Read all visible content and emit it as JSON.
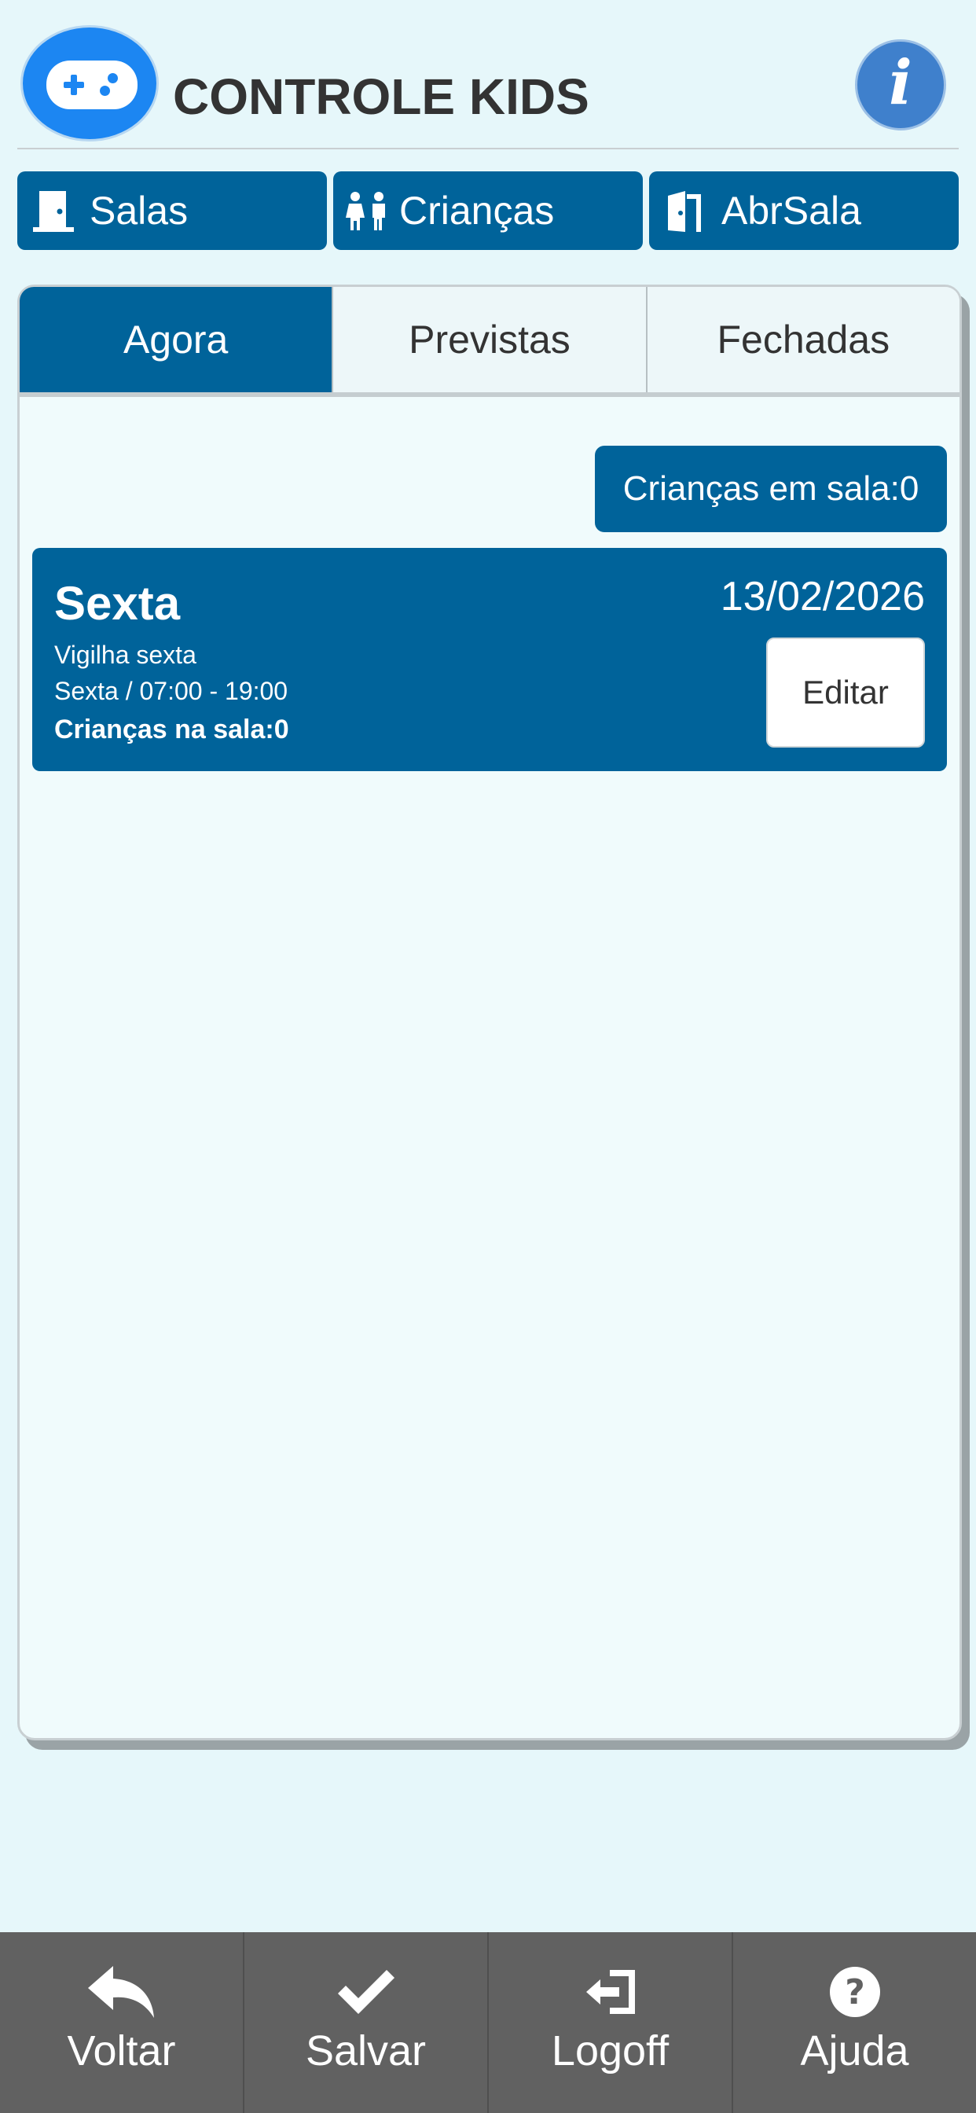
{
  "header": {
    "title": "CONTROLE KIDS",
    "info_icon": "info-icon",
    "logo_icon": "gamepad-icon",
    "info_glyph": "i"
  },
  "nav": [
    {
      "label": "Salas",
      "icon": "door-icon"
    },
    {
      "label": "Crianças",
      "icon": "children-icon"
    },
    {
      "label": "AbrSala",
      "icon": "door-open-icon"
    }
  ],
  "tabs": [
    {
      "label": "Agora",
      "active": true
    },
    {
      "label": "Previstas",
      "active": false
    },
    {
      "label": "Fechadas",
      "active": false
    }
  ],
  "summary": {
    "children_in_room": "Crianças em sala:0"
  },
  "room": {
    "name": "Sexta",
    "description": "Vigilha sexta",
    "schedule": "Sexta / 07:00 - 19:00",
    "children_count": "Crianças na sala:0",
    "date": "13/02/2026",
    "edit_label": "Editar"
  },
  "bottom_bar": [
    {
      "label": "Voltar",
      "icon": "reply-icon"
    },
    {
      "label": "Salvar",
      "icon": "check-icon"
    },
    {
      "label": "Logoff",
      "icon": "logout-icon"
    },
    {
      "label": "Ajuda",
      "icon": "help-icon"
    }
  ],
  "colors": {
    "primary": "#00639a",
    "background": "#e6f7fa",
    "bottom_bar": "#616161",
    "logo": "#1c86f2",
    "info": "#3f80cc"
  }
}
